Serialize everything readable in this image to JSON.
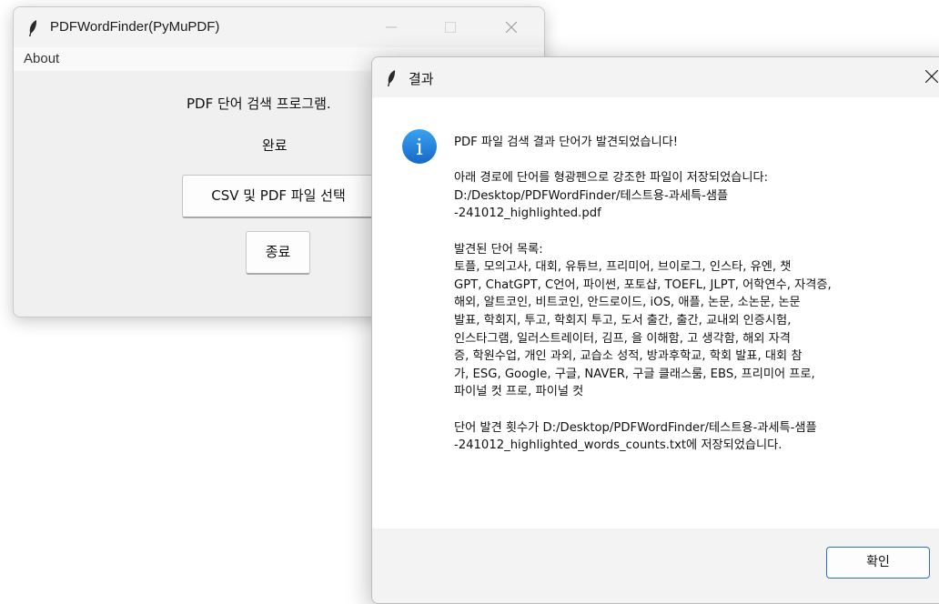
{
  "main_window": {
    "title": "PDFWordFinder(PyMuPDF)",
    "menu": {
      "about": "About"
    },
    "program_title": "PDF 단어 검색 프로그램.",
    "status": "완료",
    "select_button": "CSV 및 PDF 파일 선택",
    "quit_button": "종료"
  },
  "dialog": {
    "title": "결과",
    "icon": "info-icon",
    "lines": {
      "l1": "PDF 파일 검색 결과 단어가 발견되었습니다!",
      "l2": "아래 경로에 단어를 형광펜으로 강조한 파일이 저장되었습니다:",
      "l3": "D:/Desktop/PDFWordFinder/테스트용-과세특-샘플",
      "l4": "-241012_highlighted.pdf",
      "l5": "발견된 단어 목록:",
      "l6": "토플, 모의고사, 대회, 유튜브, 프리미어, 브이로그, 인스타, 유엔, 챗",
      "l7": "GPT, ChatGPT, C언어, 파이썬, 포토샵, TOEFL, JLPT, 어학연수, 자격증,",
      "l8": "해외, 알트코인, 비트코인, 안드로이드, iOS, 애플, 논문, 소논문, 논문",
      "l9": "발표, 학회지, 투고, 학회지 투고, 도서 출간, 출간, 교내외 인증시험,",
      "l10": "인스타그램, 일러스트레이터, 김프, 을 이해함, 고 생각함, 해외 자격",
      "l11": "증, 학원수업, 개인 과외, 교습소 성적, 방과후학교, 학회 발표, 대회 참",
      "l12": "가, ESG, Google, 구글, NAVER, 구글 클래스룸, EBS, 프리미어 프로,",
      "l13": "파이널 컷 프로, 파이널 컷",
      "l14": "단어 발견 횟수가 D:/Desktop/PDFWordFinder/테스트용-과세특-샘플",
      "l15": "-241012_highlighted_words_counts.txt에 저장되었습니다."
    },
    "ok_button": "확인"
  }
}
